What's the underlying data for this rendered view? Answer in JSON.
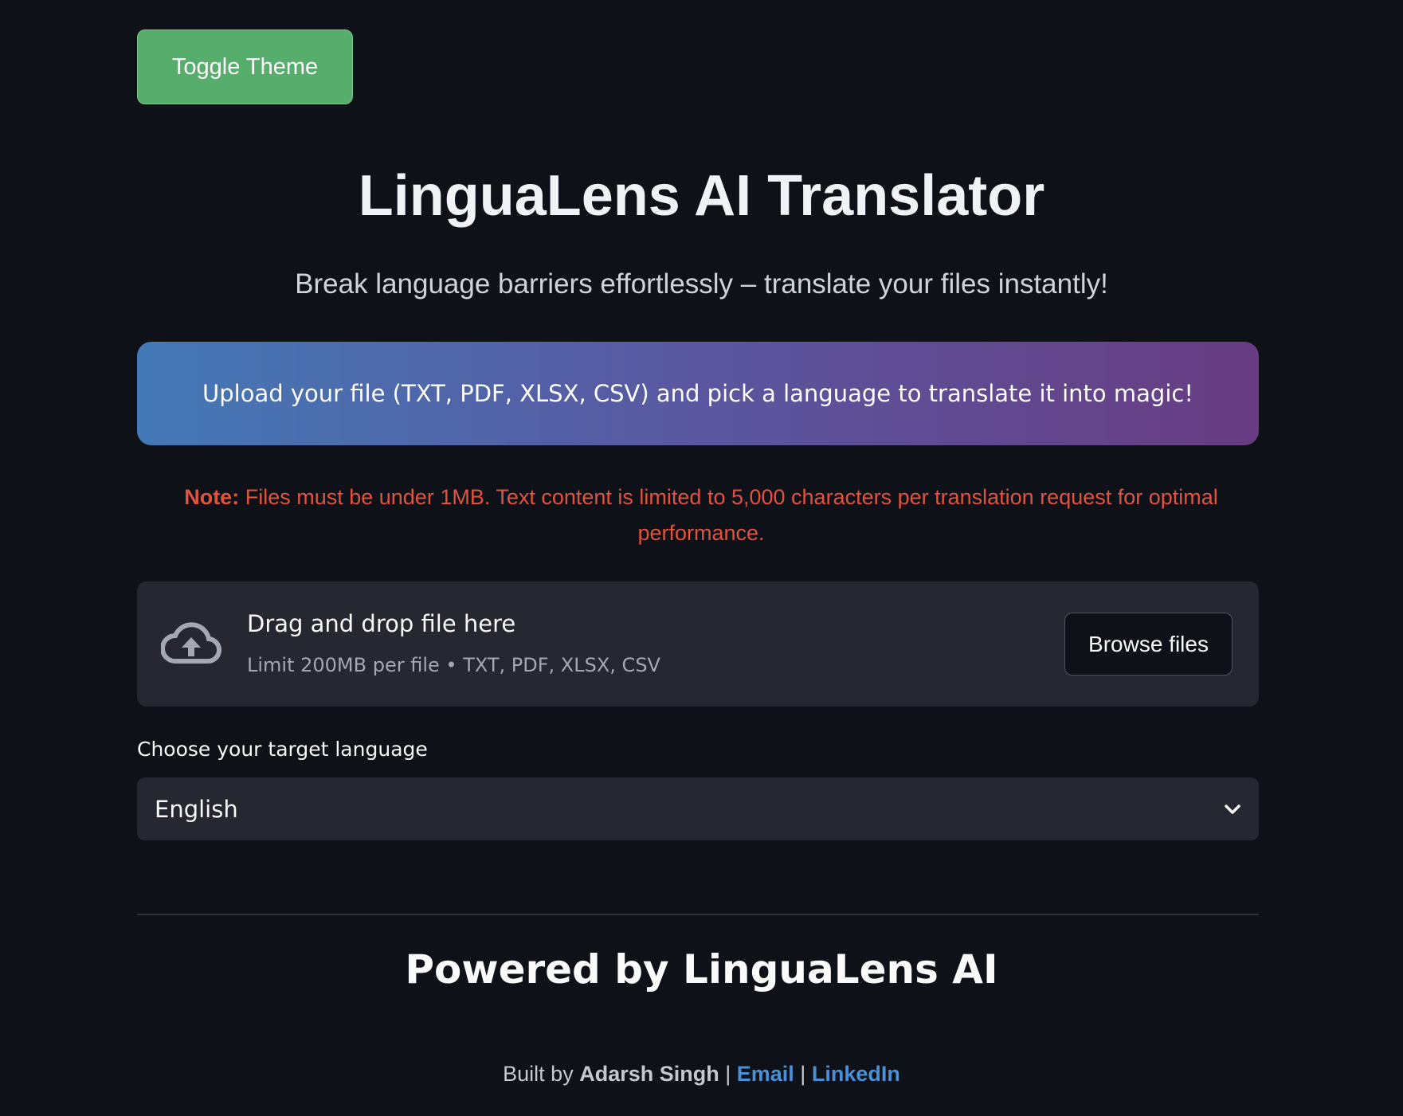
{
  "toggle_theme": "Toggle Theme",
  "title": "LinguaLens AI Translator",
  "subtitle": "Break language barriers effortlessly – translate your files instantly!",
  "banner": "Upload your file (TXT, PDF, XLSX, CSV) and pick a language to translate it into magic!",
  "note": {
    "label": "Note:",
    "text": " Files must be under 1MB. Text content is limited to 5,000 characters per translation request for optimal performance."
  },
  "uploader": {
    "icon": "cloud-upload-icon",
    "title": "Drag and drop file here",
    "limit": "Limit 200MB per file • TXT, PDF, XLSX, CSV",
    "browse": "Browse files"
  },
  "language": {
    "label": "Choose your target language",
    "selected": "English"
  },
  "powered": "Powered by LinguaLens AI",
  "footer": {
    "built_by": "Built by ",
    "author": "Adarsh Singh",
    "sep": " | ",
    "email": "Email",
    "linkedin": "LinkedIn"
  },
  "colors": {
    "background": "#0e1117",
    "toggle": "#57ad6b",
    "note": "#e0533f",
    "link": "#4a90d9"
  }
}
